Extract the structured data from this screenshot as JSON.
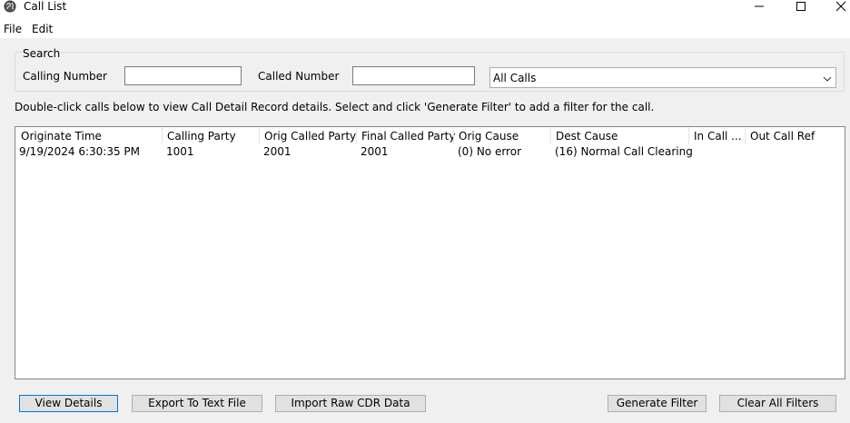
{
  "window": {
    "title": "Call List"
  },
  "menu": {
    "file": "File",
    "edit": "Edit"
  },
  "search": {
    "legend": "Search",
    "calling_label": "Calling Number",
    "calling_value": "",
    "called_label": "Called Number",
    "called_value": "",
    "filter_selected": "All Calls"
  },
  "instructions": "Double-click calls below to view Call Detail Record details. Select and click 'Generate Filter' to add a filter for the call.",
  "table": {
    "columns": [
      "Originate Time",
      "Calling Party",
      "Orig Called Party",
      "Final Called Party",
      "Orig Cause",
      "Dest Cause",
      "In Call ...",
      "Out Call Ref"
    ],
    "rows": [
      [
        "9/19/2024 6:30:35 PM",
        "1001",
        "2001",
        "2001",
        "(0) No error",
        "(16) Normal Call Clearing",
        "",
        ""
      ]
    ]
  },
  "buttons": {
    "view_details": "View Details",
    "export": "Export To Text File",
    "import": "Import Raw CDR Data",
    "generate": "Generate Filter",
    "clear": "Clear All Filters"
  },
  "icons": {
    "app": "globe-icon",
    "minimize": "minimize-icon",
    "maximize": "maximize-icon",
    "close": "close-icon",
    "dropdown": "chevron-down-icon"
  }
}
